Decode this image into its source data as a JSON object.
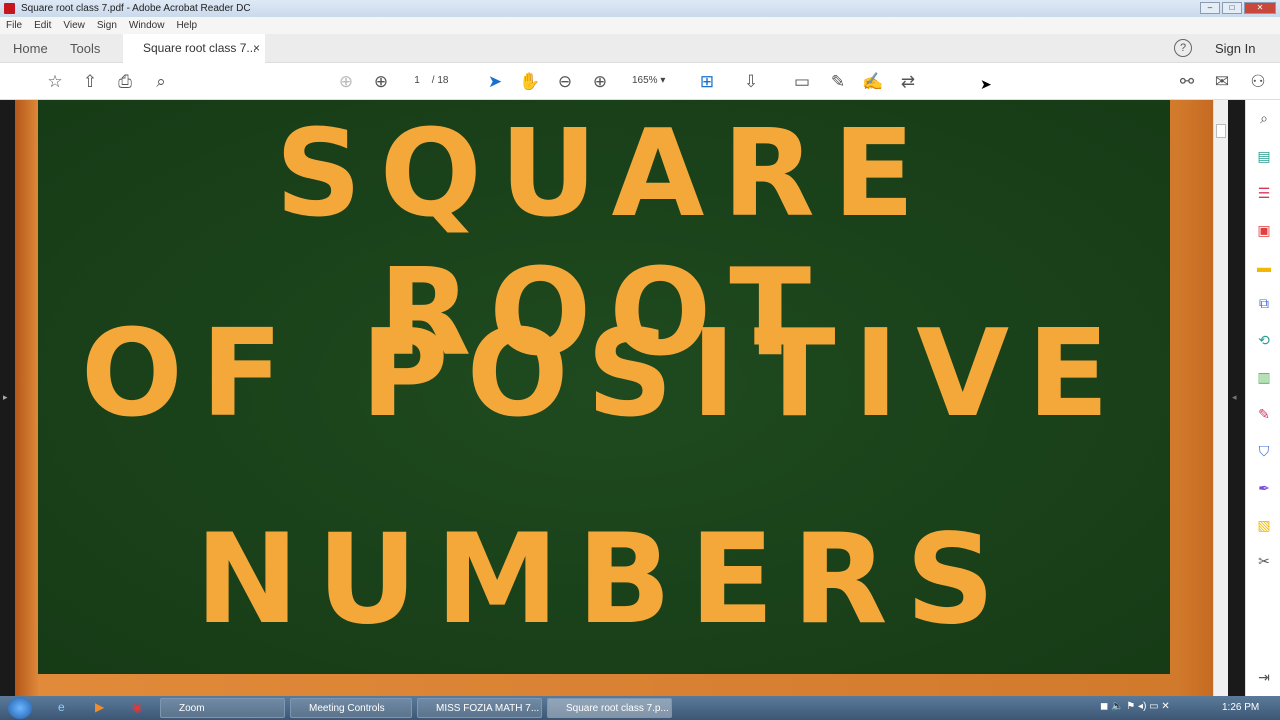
{
  "window": {
    "title": "Square root class 7.pdf - Adobe Acrobat Reader DC"
  },
  "menu": [
    "File",
    "Edit",
    "View",
    "Sign",
    "Window",
    "Help"
  ],
  "tabs": {
    "home": "Home",
    "tools": "Tools",
    "doc": "Square root class 7...",
    "close": "×"
  },
  "header": {
    "help": "?",
    "sign_in": "Sign In"
  },
  "toolbar": {
    "page_current": "1",
    "page_total": "/ 18",
    "zoom": "165%"
  },
  "document": {
    "lines": [
      "SQUARE ROOT",
      "OF POSITIVE",
      "NUMBERS"
    ]
  },
  "taskbar": {
    "items": [
      "Zoom",
      "Meeting Controls",
      "MISS FOZIA MATH 7...",
      "Square root class 7.p..."
    ],
    "time": "1:26 PM"
  }
}
